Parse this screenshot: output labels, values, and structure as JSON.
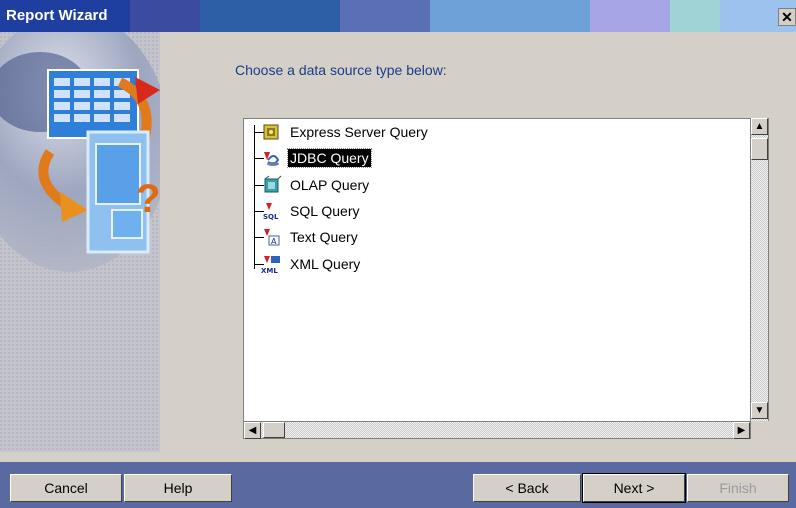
{
  "window": {
    "title": "Report Wizard",
    "close_glyph": "✕"
  },
  "titlebar_colors": [
    "#3b4ca0",
    "#2d5fa6",
    "#5a84c6",
    "#6ea1d8",
    "#8aa9e0",
    "#a6a6e6",
    "#9fd3d5",
    "#9cc2ee"
  ],
  "instruction": "Choose a data source type below:",
  "tree": {
    "items": [
      {
        "label": "Express Server Query",
        "icon": "express-server-icon",
        "selected": false
      },
      {
        "label": "JDBC Query",
        "icon": "jdbc-icon",
        "selected": true
      },
      {
        "label": "OLAP Query",
        "icon": "olap-icon",
        "selected": false
      },
      {
        "label": "SQL Query",
        "icon": "sql-icon",
        "selected": false
      },
      {
        "label": "Text Query",
        "icon": "text-query-icon",
        "selected": false
      },
      {
        "label": "XML Query",
        "icon": "xml-icon",
        "selected": false
      }
    ]
  },
  "scrollbar": {
    "up_glyph": "▲",
    "down_glyph": "▼",
    "left_glyph": "◀",
    "right_glyph": "▶"
  },
  "buttons": {
    "cancel": "Cancel",
    "help": "Help",
    "back": "< Back",
    "next": "Next >",
    "finish": "Finish"
  }
}
